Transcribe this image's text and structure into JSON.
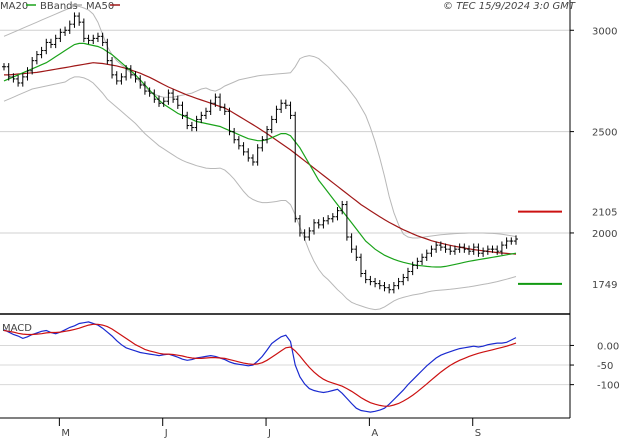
{
  "header": {
    "legend": [
      {
        "label": "MA20",
        "color": "#1aa31a"
      },
      {
        "label": "BBands",
        "color": "#b0b0b0"
      },
      {
        "label": "MA50",
        "color": "#a01818"
      }
    ],
    "copyright": "© TEC 15/9/2024 3:0 GMT"
  },
  "chart_data": [
    {
      "type": "ohlc",
      "ylim": [
        1610,
        3100
      ],
      "y_ticks": [
        2000,
        2500,
        3000
      ],
      "y_tick_labels": [
        "2000",
        "2500",
        "3000"
      ],
      "x_tick_labels": [
        "M",
        "J",
        "J",
        "A",
        "S"
      ],
      "grid": true,
      "levels": [
        {
          "label": "2105",
          "value": 2105,
          "color": "#cc1111"
        },
        {
          "label": "1749",
          "value": 1749,
          "color": "#119911"
        }
      ],
      "close": [
        2820,
        2770,
        2760,
        2740,
        2770,
        2800,
        2850,
        2880,
        2900,
        2940,
        2930,
        2960,
        2990,
        3000,
        3030,
        3070,
        3040,
        2960,
        2950,
        2960,
        2970,
        2940,
        2850,
        2780,
        2750,
        2770,
        2810,
        2780,
        2760,
        2730,
        2700,
        2690,
        2660,
        2640,
        2650,
        2690,
        2660,
        2630,
        2580,
        2530,
        2520,
        2560,
        2580,
        2600,
        2640,
        2670,
        2620,
        2600,
        2500,
        2460,
        2430,
        2400,
        2370,
        2350,
        2420,
        2460,
        2510,
        2560,
        2610,
        2640,
        2630,
        2580,
        2070,
        2000,
        1980,
        2010,
        2050,
        2040,
        2060,
        2070,
        2080,
        2110,
        2140,
        1980,
        1920,
        1880,
        1800,
        1770,
        1760,
        1750,
        1740,
        1730,
        1720,
        1740,
        1760,
        1780,
        1810,
        1840,
        1860,
        1880,
        1900,
        1920,
        1940,
        1930,
        1920,
        1910,
        1920,
        1930,
        1920,
        1910,
        1930,
        1900,
        1910,
        1920,
        1920,
        1910,
        1940,
        1960,
        1960,
        1970
      ],
      "ma20": [
        2750,
        2760,
        2770,
        2780,
        2790,
        2800,
        2810,
        2820,
        2830,
        2840,
        2855,
        2870,
        2885,
        2900,
        2915,
        2930,
        2935,
        2935,
        2930,
        2925,
        2920,
        2910,
        2895,
        2880,
        2860,
        2840,
        2820,
        2800,
        2780,
        2755,
        2730,
        2705,
        2680,
        2655,
        2635,
        2620,
        2605,
        2590,
        2580,
        2570,
        2560,
        2550,
        2545,
        2540,
        2535,
        2530,
        2525,
        2515,
        2505,
        2495,
        2485,
        2475,
        2465,
        2460,
        2455,
        2455,
        2460,
        2470,
        2480,
        2490,
        2490,
        2480,
        2450,
        2420,
        2380,
        2340,
        2300,
        2260,
        2230,
        2200,
        2170,
        2140,
        2110,
        2080,
        2050,
        2020,
        1990,
        1960,
        1940,
        1920,
        1905,
        1890,
        1880,
        1870,
        1862,
        1855,
        1850,
        1845,
        1840,
        1838,
        1835,
        1833,
        1832,
        1832,
        1835,
        1840,
        1845,
        1850,
        1855,
        1860,
        1864,
        1868,
        1872,
        1876,
        1880,
        1884,
        1888,
        1892,
        1896,
        1900
      ],
      "ma50": [
        2780,
        2780,
        2782,
        2784,
        2786,
        2788,
        2790,
        2792,
        2796,
        2800,
        2804,
        2808,
        2812,
        2816,
        2820,
        2824,
        2828,
        2832,
        2836,
        2840,
        2838,
        2836,
        2832,
        2828,
        2824,
        2818,
        2812,
        2804,
        2796,
        2788,
        2778,
        2768,
        2756,
        2744,
        2732,
        2720,
        2710,
        2700,
        2690,
        2680,
        2672,
        2664,
        2656,
        2648,
        2640,
        2632,
        2624,
        2616,
        2604,
        2590,
        2576,
        2562,
        2548,
        2534,
        2520,
        2505,
        2490,
        2474,
        2458,
        2442,
        2426,
        2410,
        2392,
        2374,
        2356,
        2338,
        2320,
        2302,
        2284,
        2266,
        2248,
        2230,
        2212,
        2194,
        2176,
        2158,
        2140,
        2125,
        2110,
        2095,
        2080,
        2066,
        2052,
        2040,
        2028,
        2016,
        2006,
        1996,
        1986,
        1978,
        1970,
        1962,
        1956,
        1950,
        1944,
        1939,
        1934,
        1930,
        1926,
        1922,
        1918,
        1915,
        1912,
        1909,
        1906,
        1903,
        1901,
        1899,
        1897,
        1895
      ],
      "bb_upper": [
        2970,
        2980,
        2990,
        3000,
        3010,
        3020,
        3030,
        3040,
        3050,
        3060,
        3070,
        3080,
        3090,
        3100,
        3110,
        3120,
        3118,
        3110,
        3100,
        3080,
        3040,
        2980,
        2920,
        2880,
        2850,
        2830,
        2810,
        2790,
        2770,
        2745,
        2720,
        2700,
        2685,
        2675,
        2670,
        2670,
        2670,
        2675,
        2680,
        2685,
        2690,
        2700,
        2710,
        2715,
        2705,
        2700,
        2710,
        2725,
        2735,
        2745,
        2755,
        2760,
        2765,
        2770,
        2775,
        2778,
        2780,
        2782,
        2784,
        2786,
        2788,
        2790,
        2820,
        2860,
        2870,
        2875,
        2870,
        2860,
        2840,
        2820,
        2795,
        2770,
        2745,
        2720,
        2690,
        2660,
        2620,
        2580,
        2520,
        2450,
        2370,
        2280,
        2180,
        2100,
        2040,
        1995,
        1980,
        1975,
        1975,
        1978,
        1982,
        1985,
        1988,
        1991,
        1993,
        1995,
        1997,
        1998,
        1999,
        2000,
        2000,
        2000,
        2000,
        1999,
        1998,
        1996,
        1994,
        1990,
        1986,
        1982
      ],
      "bb_lower": [
        2650,
        2660,
        2670,
        2680,
        2690,
        2700,
        2710,
        2715,
        2720,
        2725,
        2730,
        2735,
        2740,
        2745,
        2760,
        2770,
        2770,
        2765,
        2755,
        2740,
        2715,
        2690,
        2660,
        2640,
        2620,
        2600,
        2580,
        2560,
        2540,
        2515,
        2490,
        2470,
        2450,
        2430,
        2415,
        2400,
        2385,
        2370,
        2358,
        2348,
        2340,
        2332,
        2326,
        2320,
        2318,
        2318,
        2320,
        2310,
        2290,
        2265,
        2235,
        2205,
        2180,
        2165,
        2155,
        2150,
        2150,
        2152,
        2155,
        2160,
        2160,
        2140,
        2090,
        2030,
        1970,
        1910,
        1860,
        1820,
        1790,
        1770,
        1745,
        1720,
        1700,
        1675,
        1658,
        1648,
        1640,
        1632,
        1626,
        1622,
        1625,
        1635,
        1650,
        1665,
        1675,
        1682,
        1688,
        1694,
        1698,
        1702,
        1708,
        1713,
        1716,
        1718,
        1720,
        1722,
        1725,
        1728,
        1731,
        1734,
        1738,
        1742,
        1746,
        1750,
        1755,
        1760,
        1766,
        1772,
        1778,
        1785
      ]
    },
    {
      "type": "line",
      "title": "MACD",
      "ylim": [
        -180,
        70
      ],
      "y_ticks": [
        0,
        -50,
        -100
      ],
      "y_tick_labels": [
        "0.00",
        "-50",
        "-100"
      ],
      "grid": true,
      "series": [
        {
          "color": "#1a2ad0",
          "values": [
            40,
            34,
            28,
            24,
            18,
            22,
            28,
            32,
            36,
            38,
            33,
            30,
            34,
            40,
            46,
            50,
            56,
            58,
            60,
            56,
            52,
            44,
            34,
            24,
            12,
            2,
            -6,
            -10,
            -14,
            -18,
            -20,
            -22,
            -24,
            -26,
            -24,
            -22,
            -26,
            -30,
            -35,
            -38,
            -36,
            -32,
            -30,
            -28,
            -26,
            -28,
            -32,
            -36,
            -42,
            -46,
            -48,
            -50,
            -52,
            -50,
            -40,
            -28,
            -12,
            5,
            14,
            22,
            26,
            10,
            -50,
            -80,
            -98,
            -110,
            -115,
            -118,
            -120,
            -118,
            -115,
            -112,
            -122,
            -135,
            -148,
            -160,
            -166,
            -168,
            -170,
            -168,
            -165,
            -160,
            -150,
            -138,
            -126,
            -114,
            -100,
            -88,
            -76,
            -64,
            -52,
            -42,
            -32,
            -25,
            -20,
            -16,
            -12,
            -8,
            -6,
            -4,
            -2,
            -4,
            -2,
            2,
            4,
            6,
            6,
            8,
            14,
            20
          ]
        },
        {
          "color": "#cc1111",
          "values": [
            38,
            36,
            34,
            31,
            29,
            28,
            28,
            29,
            30,
            32,
            33,
            33,
            34,
            36,
            38,
            41,
            44,
            48,
            52,
            54,
            54,
            52,
            48,
            42,
            34,
            26,
            18,
            10,
            2,
            -4,
            -10,
            -14,
            -17,
            -20,
            -22,
            -22,
            -23,
            -25,
            -27,
            -30,
            -32,
            -33,
            -33,
            -32,
            -31,
            -31,
            -32,
            -33,
            -36,
            -39,
            -42,
            -45,
            -47,
            -48,
            -47,
            -44,
            -38,
            -30,
            -22,
            -14,
            -6,
            -4,
            -14,
            -27,
            -42,
            -56,
            -68,
            -78,
            -86,
            -92,
            -96,
            -100,
            -104,
            -110,
            -117,
            -125,
            -133,
            -140,
            -146,
            -150,
            -153,
            -155,
            -155,
            -152,
            -148,
            -142,
            -135,
            -127,
            -118,
            -108,
            -98,
            -88,
            -78,
            -68,
            -59,
            -51,
            -44,
            -38,
            -33,
            -28,
            -24,
            -20,
            -17,
            -14,
            -11,
            -8,
            -5,
            -2,
            2,
            6
          ]
        }
      ]
    }
  ]
}
